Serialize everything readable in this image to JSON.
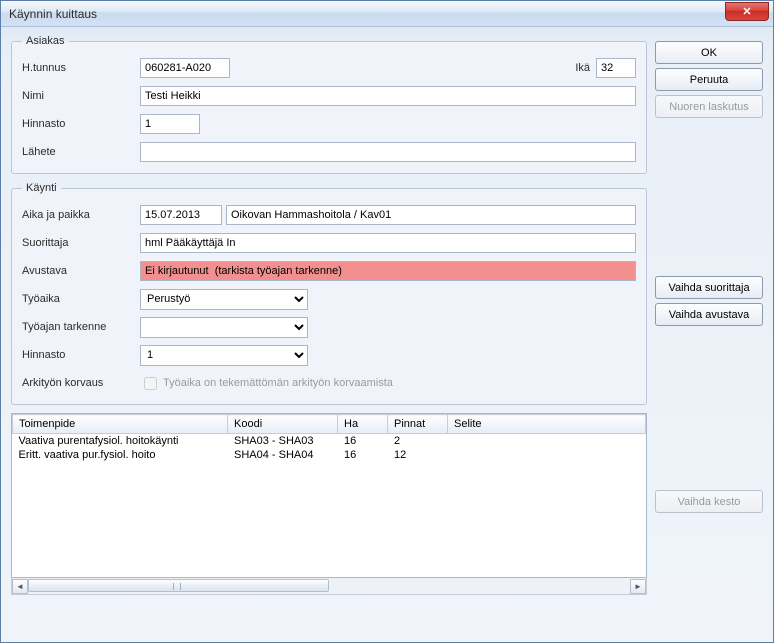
{
  "window_title": "Käynnin kuittaus",
  "buttons": {
    "ok": "OK",
    "cancel": "Peruuta",
    "nuoren_laskutus": "Nuoren laskutus",
    "vaihda_suorittaja": "Vaihda suorittaja",
    "vaihda_avustava": "Vaihda avustava",
    "vaihda_kesto": "Vaihda kesto"
  },
  "asiakas": {
    "legend": "Asiakas",
    "htunnus_label": "H.tunnus",
    "htunnus_value": "060281-A020",
    "ika_label": "Ikä",
    "ika_value": "32",
    "nimi_label": "Nimi",
    "nimi_value": "Testi Heikki",
    "hinnasto_label": "Hinnasto",
    "hinnasto_value": "1",
    "lahete_label": "Lähete",
    "lahete_value": ""
  },
  "kaynti": {
    "legend": "Käynti",
    "aika_label": "Aika ja paikka",
    "aika_date": "15.07.2013",
    "aika_place": "Oikovan Hammashoitola / Kav01",
    "suorittaja_label": "Suorittaja",
    "suorittaja_value": "hml Pääkäyttäjä In",
    "avustava_label": "Avustava",
    "avustava_value": "Ei kirjautunut  (tarkista työajan tarkenne)",
    "tyoaika_label": "Työaika",
    "tyoaika_value": "Perustyö",
    "tyotarkenne_label": "Työajan tarkenne",
    "tyotarkenne_value": "",
    "hinnasto_label": "Hinnasto",
    "hinnasto_value": "1",
    "arkityo_label": "Arkityön korvaus",
    "arkityo_checkbox_label": "Työaika on tekemättömän arkityön korvaamista"
  },
  "table": {
    "headers": {
      "toimenpide": "Toimenpide",
      "koodi": "Koodi",
      "ha": "Ha",
      "pinnat": "Pinnat",
      "selite": "Selite"
    },
    "rows": [
      {
        "toimenpide": "Vaativa purentafysiol. hoitokäynti",
        "koodi": "SHA03 - SHA03",
        "ha": "16",
        "pinnat": "2",
        "selite": ""
      },
      {
        "toimenpide": "Eritt. vaativa pur.fysiol. hoito",
        "koodi": "SHA04 - SHA04",
        "ha": "16",
        "pinnat": "12",
        "selite": ""
      }
    ]
  }
}
